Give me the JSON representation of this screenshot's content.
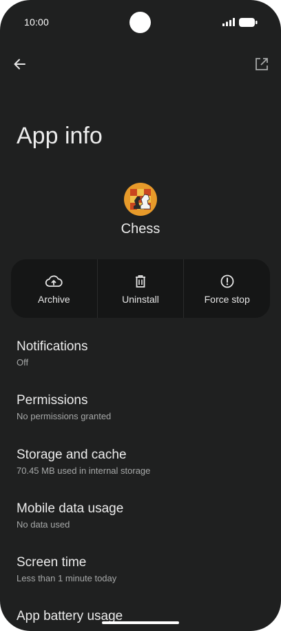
{
  "status_bar": {
    "time": "10:00"
  },
  "header": {
    "title": "App info"
  },
  "app": {
    "name": "Chess"
  },
  "actions": [
    {
      "label": "Archive",
      "icon": "cloud-upload-icon"
    },
    {
      "label": "Uninstall",
      "icon": "trash-icon"
    },
    {
      "label": "Force stop",
      "icon": "alert-circle-icon"
    }
  ],
  "settings": [
    {
      "title": "Notifications",
      "subtitle": "Off"
    },
    {
      "title": "Permissions",
      "subtitle": "No permissions granted"
    },
    {
      "title": "Storage and cache",
      "subtitle": "70.45 MB used in internal storage"
    },
    {
      "title": "Mobile data usage",
      "subtitle": "No data used"
    },
    {
      "title": "Screen time",
      "subtitle": "Less than 1 minute today"
    },
    {
      "title": "App battery usage",
      "subtitle": ""
    }
  ],
  "colors": {
    "background": "#1f2020",
    "action_panel": "#151616",
    "text_primary": "#ececec",
    "text_secondary": "#a7a9a9"
  }
}
